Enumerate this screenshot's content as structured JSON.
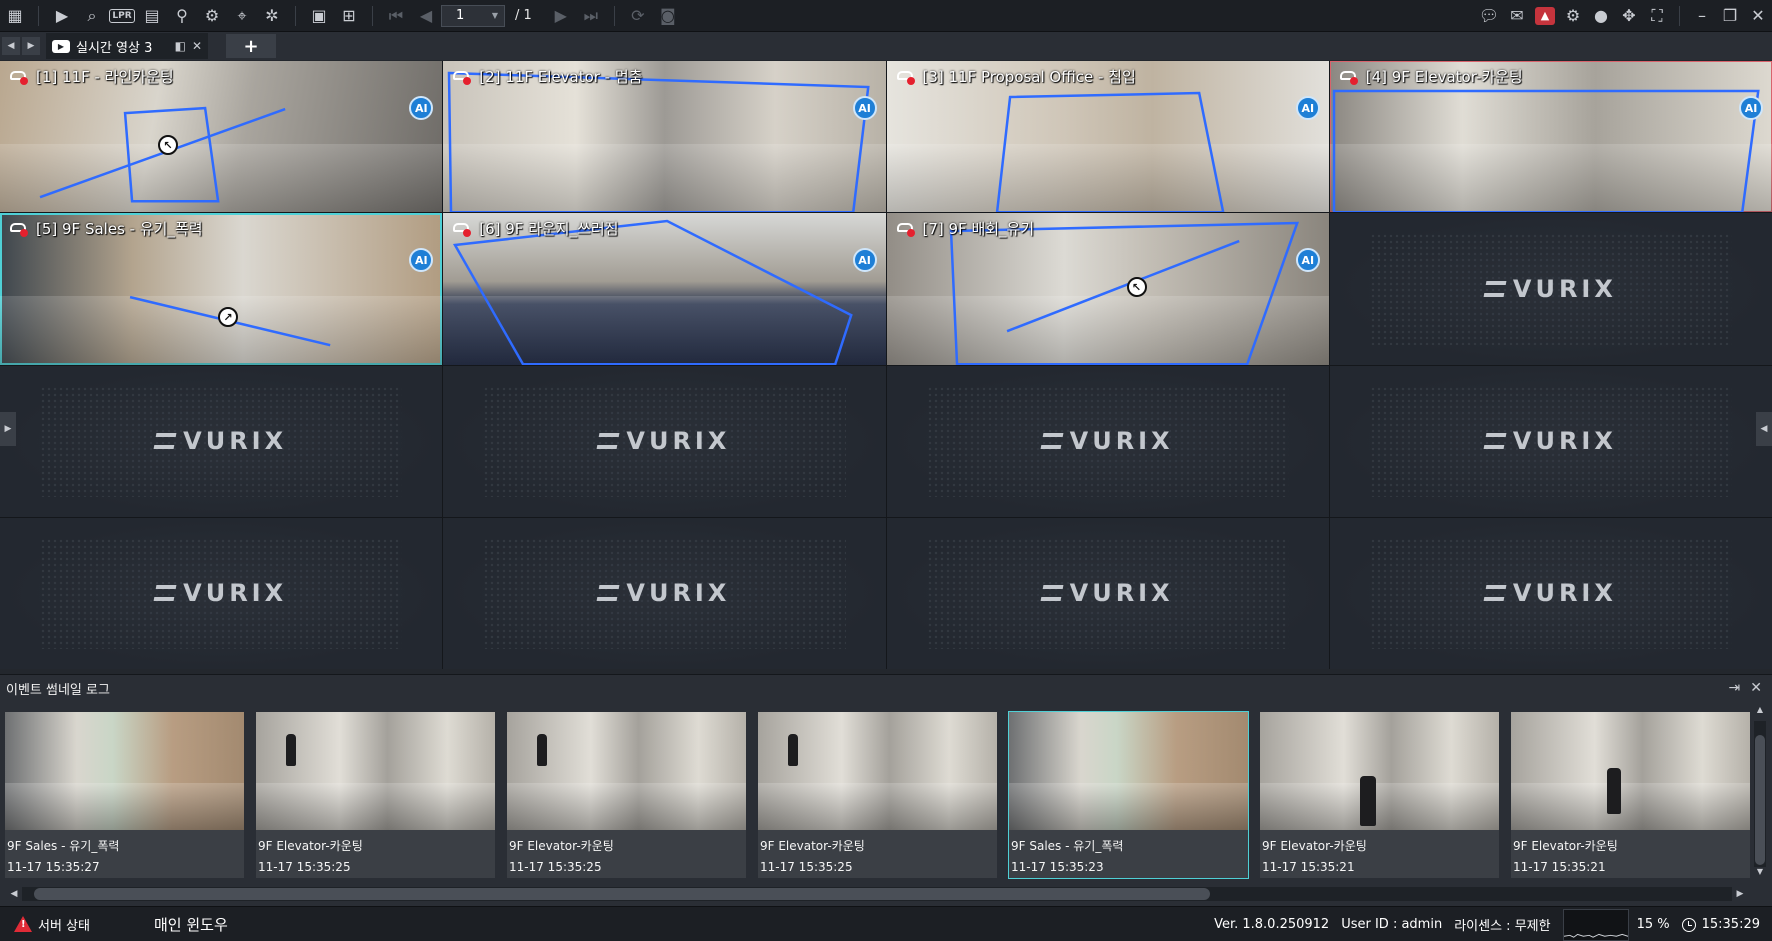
{
  "toolbar": {
    "left_icons": [
      "grid-menu-icon",
      "live-play-icon",
      "playback-search-icon",
      "lpr-icon",
      "event-icon",
      "person-search-icon",
      "bicycle-icon",
      "map-icon",
      "settings-search-icon",
      "layout-icon",
      "add-screen-icon"
    ],
    "lpr_label": "LPR",
    "page_current": "1",
    "page_total": "/ 1",
    "right_icons": [
      "chat-icon",
      "message-icon",
      "alarm-icon",
      "gear-icon",
      "user-icon",
      "move-icon",
      "fullscreen-icon",
      "minimize-icon",
      "restore-icon",
      "close-icon"
    ]
  },
  "tab": {
    "label": "실시간 영상 3",
    "add_label": "+"
  },
  "cameras": [
    {
      "title": "[1] 11F - 라인카운팅"
    },
    {
      "title": "[2] 11F Elevator - 멈춤"
    },
    {
      "title": "[3] 11F Proposal Office - 침입"
    },
    {
      "title": "[4] 9F Elevator-카운팅"
    },
    {
      "title": "[5] 9F Sales - 유기_폭력"
    },
    {
      "title": "[6] 9F 라운지_쓰러짐"
    },
    {
      "title": "[7] 9F 배회_유기"
    }
  ],
  "empty_logo": "VURIX",
  "event_log": {
    "title": "이벤트 썸네일 로그",
    "items": [
      {
        "name": "9F Sales - 유기_폭력",
        "time": "11-17 15:35:27"
      },
      {
        "name": "9F Elevator-카운팅",
        "time": "11-17 15:35:25"
      },
      {
        "name": "9F Elevator-카운팅",
        "time": "11-17 15:35:25"
      },
      {
        "name": "9F Elevator-카운팅",
        "time": "11-17 15:35:25"
      },
      {
        "name": "9F Sales - 유기_폭력",
        "time": "11-17 15:35:23"
      },
      {
        "name": "9F Elevator-카운팅",
        "time": "11-17 15:35:21"
      },
      {
        "name": "9F Elevator-카운팅",
        "time": "11-17 15:35:21"
      }
    ]
  },
  "status": {
    "server": "서버 상태",
    "window": "매인 윈도우",
    "version": "Ver. 1.8.0.250912",
    "user": "User ID : admin",
    "license": "라이센스 : 무제한",
    "cpu": "15 %",
    "clock": "15:35:29"
  },
  "colors": {
    "background": "#23272d",
    "toolbar": "#1c1f24",
    "accent_cyan": "#4fd0d6",
    "roi_blue": "#2f6bff",
    "rec_red": "#e5202e",
    "alarm_red": "#c5343d"
  }
}
